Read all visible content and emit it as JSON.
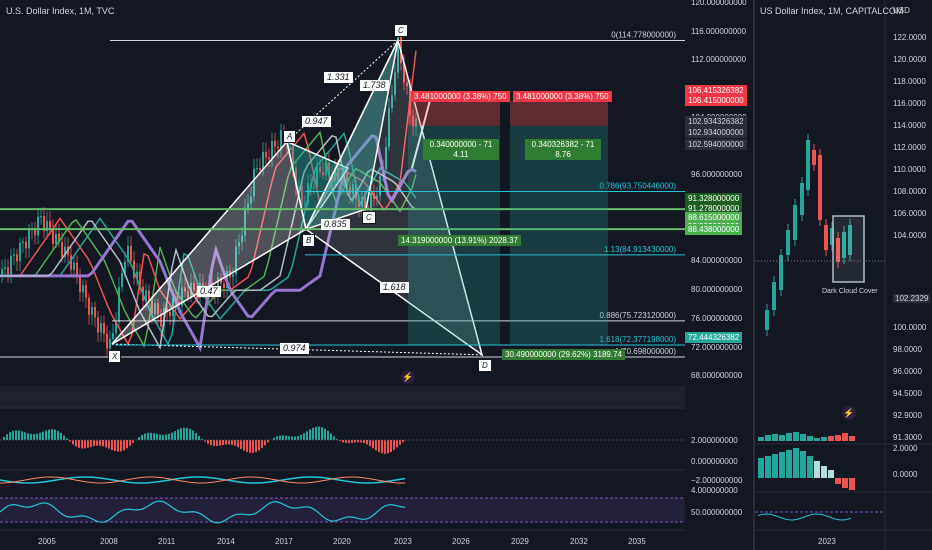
{
  "left_chart": {
    "title": "U.S. Dollar Index, 1M, TVC",
    "x_labels": [
      "2005",
      "2008",
      "2011",
      "2014",
      "2017",
      "2020",
      "2023",
      "2026",
      "2029",
      "2032",
      "2035"
    ],
    "y_labels": [
      "120.000000000",
      "116.000000000",
      "112.000000000",
      "108.000000000",
      "104.000000000",
      "100.000000000",
      "96.000000000",
      "92.000000000",
      "88.000000000",
      "84.000000000",
      "80.000000000",
      "76.000000000",
      "72.000000000",
      "68.000000000"
    ],
    "macd_labels": [
      "2.000000000",
      "0.000000000",
      "−2.000000000",
      "4.000000000"
    ],
    "rsi_label": "50.000000000",
    "price_badges": [
      {
        "text": "106.415326382",
        "bg": "#f23645",
        "fg": "#ffffff"
      },
      {
        "text": "106.415000000",
        "bg": "#f23645",
        "fg": "#ffffff"
      },
      {
        "text": "102.934326382",
        "bg": "#2a2e39",
        "fg": "#d1d4dc"
      },
      {
        "text": "102.934000000",
        "bg": "#2a2e39",
        "fg": "#d1d4dc"
      },
      {
        "text": "102.594000000",
        "bg": "#2a2e39",
        "fg": "#d1d4dc"
      },
      {
        "text": "91.328000000",
        "bg": "#1b5e20",
        "fg": "#ffffff"
      },
      {
        "text": "91.278000000",
        "bg": "#1b5e20",
        "fg": "#ffffff"
      },
      {
        "text": "90.951000000",
        "bg": "#4caf50",
        "fg": "#ffffff"
      },
      {
        "text": "88.615000000",
        "bg": "#4caf50",
        "fg": "#ffffff"
      },
      {
        "text": "88.438000000",
        "bg": "#4caf50",
        "fg": "#ffffff"
      },
      {
        "text": "72.444326382",
        "bg": "#26a69a",
        "fg": "#ffffff"
      }
    ],
    "fib_levels": [
      {
        "text": "0(114.778000000)",
        "color": "#d1d4dc"
      },
      {
        "text": "0.786(93.750446000)",
        "color": "#26c6da"
      },
      {
        "text": "1.13(84.913430000)",
        "color": "#26c6da"
      },
      {
        "text": "0.886(75.723120000)",
        "color": "#d1d4dc"
      },
      {
        "text": "1.618(72.377198000)",
        "color": "#26c6da"
      },
      {
        "text": "1(70.698000000)",
        "color": "#d1d4dc"
      }
    ],
    "pattern_points": [
      "X",
      "A",
      "B",
      "C",
      "D",
      "C"
    ],
    "ratios": [
      "0.47",
      "0.947",
      "1.331",
      "1.738",
      "0.835",
      "1.618",
      "0.974"
    ],
    "short_boxes": [
      {
        "top": "3.481000000 (3.38%) 750",
        "bottom_1": "0.340000000 - 71",
        "bottom_2": "4.11"
      },
      {
        "top": "3.481000000 (3.38%) 750",
        "bottom_1": "0.340326382 - 71",
        "bottom_2": "8.76"
      }
    ],
    "move_labels": [
      "14.319000000 (13.91%) 2028.37",
      "30.490000000 (29.62%) 3189.74"
    ]
  },
  "right_chart": {
    "title": "US Dollar Index, 1M, CAPITALCOM",
    "currency": "USD",
    "y_labels": [
      "122.0000",
      "120.0000",
      "118.0000",
      "116.0000",
      "114.0000",
      "112.0000",
      "110.0000",
      "108.0000",
      "106.0000",
      "104.0000",
      "102.2329",
      "100.0000",
      "98.0000",
      "96.0000",
      "94.5000",
      "92.9000",
      "91.3000"
    ],
    "macd_labels": [
      "2.0000",
      "0.0000"
    ],
    "annotation": "Dark Cloud Cover",
    "x_label": "2023",
    "last_price_color": "#2a2e39"
  },
  "colors": {
    "bg": "#131722",
    "up": "#26a69a",
    "down": "#ef5350",
    "grid": "#2a2e39"
  }
}
